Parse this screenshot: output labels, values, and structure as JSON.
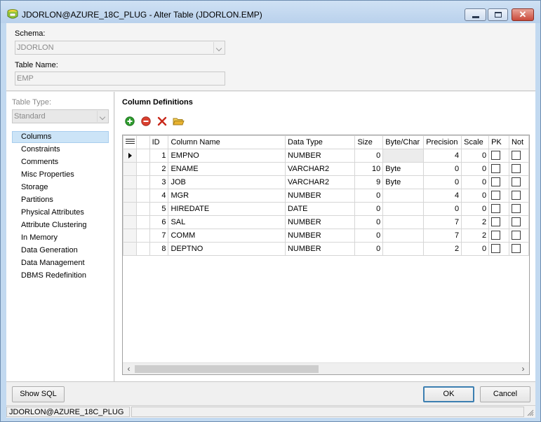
{
  "window": {
    "title": "JDORLON@AZURE_18C_PLUG - Alter Table (JDORLON.EMP)"
  },
  "header": {
    "schema_label": "Schema:",
    "schema_value": "JDORLON",
    "table_name_label": "Table Name:",
    "table_name_value": "EMP"
  },
  "left": {
    "table_type_label": "Table Type:",
    "table_type_value": "Standard",
    "nav": [
      "Columns",
      "Constraints",
      "Comments",
      "Misc Properties",
      "Storage",
      "Partitions",
      "Physical Attributes",
      "Attribute Clustering",
      "In Memory",
      "Data Generation",
      "Data Management",
      "DBMS Redefinition"
    ],
    "selected": "Columns"
  },
  "main": {
    "section_title": "Column Definitions",
    "toolbar_icons": [
      "add-icon",
      "remove-icon",
      "delete-icon",
      "open-folder-icon"
    ],
    "columns": [
      "ID",
      "Column Name",
      "Data Type",
      "Size",
      "Byte/Char",
      "Precision",
      "Scale",
      "PK",
      "Not"
    ],
    "rows": [
      {
        "id": "1",
        "name": "EMPNO",
        "type": "NUMBER",
        "size": "0",
        "bytechar": "",
        "precision": "4",
        "scale": "0"
      },
      {
        "id": "2",
        "name": "ENAME",
        "type": "VARCHAR2",
        "size": "10",
        "bytechar": "Byte",
        "precision": "0",
        "scale": "0"
      },
      {
        "id": "3",
        "name": "JOB",
        "type": "VARCHAR2",
        "size": "9",
        "bytechar": "Byte",
        "precision": "0",
        "scale": "0"
      },
      {
        "id": "4",
        "name": "MGR",
        "type": "NUMBER",
        "size": "0",
        "bytechar": "",
        "precision": "4",
        "scale": "0"
      },
      {
        "id": "5",
        "name": "HIREDATE",
        "type": "DATE",
        "size": "0",
        "bytechar": "",
        "precision": "0",
        "scale": "0"
      },
      {
        "id": "6",
        "name": "SAL",
        "type": "NUMBER",
        "size": "0",
        "bytechar": "",
        "precision": "7",
        "scale": "2"
      },
      {
        "id": "7",
        "name": "COMM",
        "type": "NUMBER",
        "size": "0",
        "bytechar": "",
        "precision": "7",
        "scale": "2"
      },
      {
        "id": "8",
        "name": "DEPTNO",
        "type": "NUMBER",
        "size": "0",
        "bytechar": "",
        "precision": "2",
        "scale": "0"
      }
    ]
  },
  "footer": {
    "show_sql_label": "Show SQL",
    "ok_label": "OK",
    "cancel_label": "Cancel",
    "status_connection": "JDORLON@AZURE_18C_PLUG"
  },
  "colors": {
    "titlebar": "#c2d9f0",
    "selection": "#cce4f7",
    "close_button": "#c9493a",
    "add_icon": "#2e9b2e",
    "remove_icon": "#d9402f",
    "folder_icon": "#e8b230"
  }
}
